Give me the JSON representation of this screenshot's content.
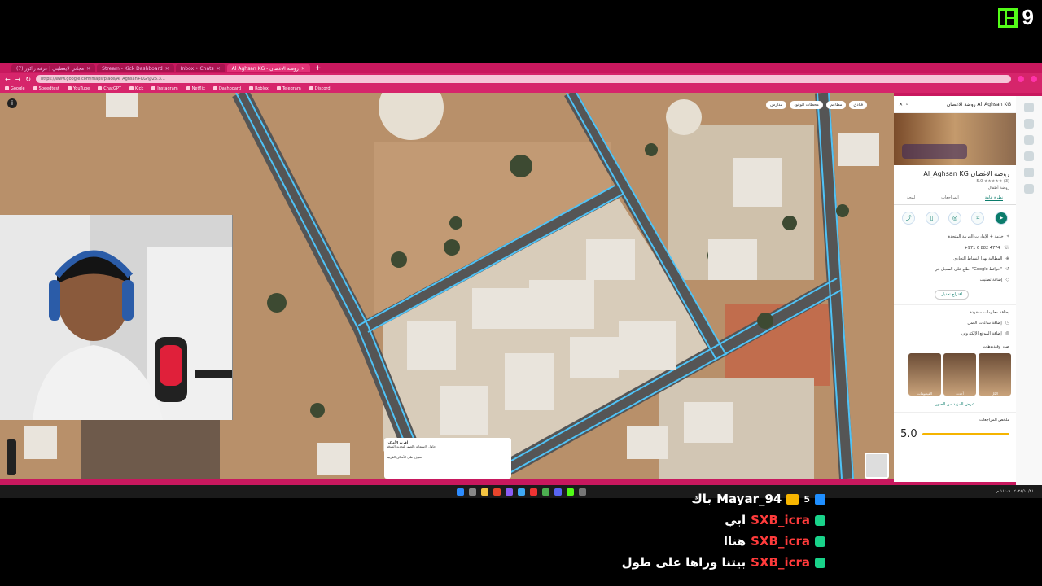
{
  "stream": {
    "kick_logo_letter": "K",
    "viewer_count": "9"
  },
  "browser": {
    "tabs": [
      {
        "label": "(7) مجاني لايعطيني | غرفة راكور",
        "active": false
      },
      {
        "label": "Stream - Kick Dashboard",
        "active": false
      },
      {
        "label": "Inbox • Chats",
        "active": false
      },
      {
        "label": "Al Aghsan KG - روضة الاغصان",
        "active": true
      }
    ],
    "url": "https://www.google.com/maps/place/Al_Aghsan+KG/@25.3…",
    "bookmarks": [
      "Google",
      "Speedtest",
      "YouTube",
      "ChatGPT",
      "Kick",
      "Instagram",
      "Netflix",
      "Dashboard",
      "Roblox",
      "Telegram",
      "Discord"
    ]
  },
  "map": {
    "chips": [
      "مدارس",
      "محطات الوقود",
      "مطاعم",
      "فنادق"
    ],
    "label_gps": "",
    "popup_title": "أقرب الأماكن",
    "popup_line1": "حاول الاستعانة بالصور لتحديد الموقع",
    "popup_line2": "تعرف على الأماكن القريبة"
  },
  "place": {
    "search_text": "روضة الاغصان Al_Aghsan KG",
    "name": "Al_Aghsan KG روضة الاغصان",
    "rating": "5.0 ★★★★★ (3)",
    "category": "روضة أطفال",
    "tabs": [
      "نظرة عامة",
      "المراجعات",
      "لمحة"
    ],
    "actions": [
      "الاتجاهات",
      "حفظ",
      "قريب",
      "إرسال إلى هاتفك",
      "مشاركة"
    ],
    "address": "خدمة + الإمارات العربية المتحدة",
    "phone": "+971 6 882 4774",
    "claim": "المطالبة بهذا النشاط التجاري",
    "history": "اطلع على السجل في \"Google خرائط\"",
    "label": "إضافة تصنيف",
    "suggest": "اقتراح تعديل",
    "add_info": "إضافة معلومات مفقودة",
    "add_hours": "إضافة ساعات العمل",
    "add_website": "إضافة الموقع الإلكتروني",
    "photos_title": "صور وفيديوهات",
    "photo_labels": [
      "الكل",
      "أحدث",
      "الفيديوهات"
    ],
    "more_photos": "عرض المزيد من الصور",
    "reviews_title": "ملخص المراجعات",
    "score": "5.0"
  },
  "taskbar": {
    "time": "١١:٠٩ م",
    "date": "٢٠٢٤/١٠/٢١"
  },
  "chat": [
    {
      "user": "Mayar_94",
      "text": "باك",
      "badge": "gold",
      "sub": "5"
    },
    {
      "user": "SXB_icra",
      "text": "ابي",
      "badge": "green"
    },
    {
      "user": "SXB_icra",
      "text": "هناا",
      "badge": "green"
    },
    {
      "user": "SXB_icra",
      "text": "بيتنا وراها على طول",
      "badge": "green"
    }
  ],
  "colors": {
    "browser_frame": "#c8185e",
    "road_line": "#4fc3f7",
    "kick_green": "#53fc18",
    "user_mayar": "#ffffff",
    "user_sxb": "#ff3b3b"
  }
}
